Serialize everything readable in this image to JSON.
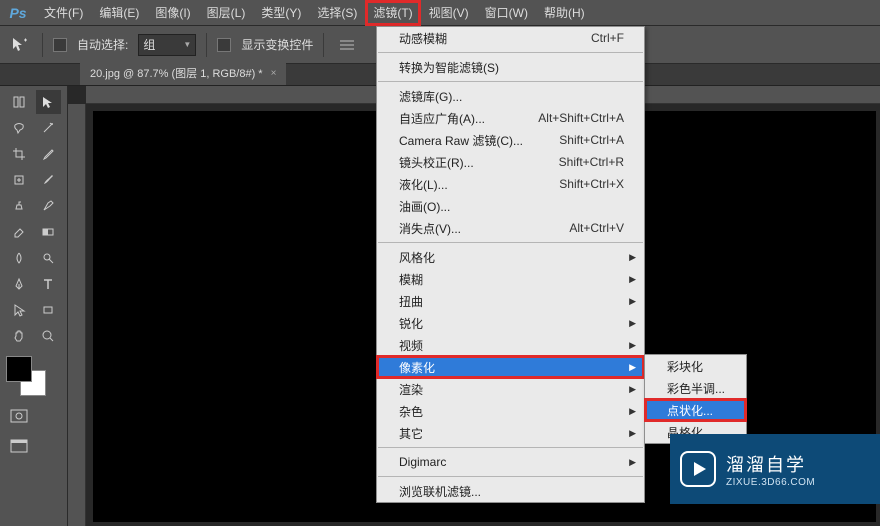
{
  "app": {
    "logo": "Ps"
  },
  "menubar": [
    "文件(F)",
    "编辑(E)",
    "图像(I)",
    "图层(L)",
    "类型(Y)",
    "选择(S)",
    "滤镜(T)",
    "视图(V)",
    "窗口(W)",
    "帮助(H)"
  ],
  "menubar_highlight_index": 6,
  "options": {
    "auto_select_label": "自动选择:",
    "auto_select_value": "组",
    "show_transform_label": "显示变换控件"
  },
  "tab": {
    "title": "20.jpg @ 87.7% (图层 1, RGB/8#) *",
    "close": "×"
  },
  "filter_menu": [
    {
      "label": "动感模糊",
      "shortcut": "Ctrl+F"
    },
    {
      "sep": true
    },
    {
      "label": "转换为智能滤镜(S)"
    },
    {
      "sep": true
    },
    {
      "label": "滤镜库(G)..."
    },
    {
      "label": "自适应广角(A)...",
      "shortcut": "Alt+Shift+Ctrl+A"
    },
    {
      "label": "Camera Raw 滤镜(C)...",
      "shortcut": "Shift+Ctrl+A"
    },
    {
      "label": "镜头校正(R)...",
      "shortcut": "Shift+Ctrl+R"
    },
    {
      "label": "液化(L)...",
      "shortcut": "Shift+Ctrl+X"
    },
    {
      "label": "油画(O)..."
    },
    {
      "label": "消失点(V)...",
      "shortcut": "Alt+Ctrl+V"
    },
    {
      "sep": true
    },
    {
      "label": "风格化",
      "sub": true
    },
    {
      "label": "模糊",
      "sub": true
    },
    {
      "label": "扭曲",
      "sub": true
    },
    {
      "label": "锐化",
      "sub": true
    },
    {
      "label": "视频",
      "sub": true
    },
    {
      "label": "像素化",
      "sub": true,
      "selected": true,
      "hl": true
    },
    {
      "label": "渲染",
      "sub": true
    },
    {
      "label": "杂色",
      "sub": true
    },
    {
      "label": "其它",
      "sub": true
    },
    {
      "sep": true
    },
    {
      "label": "Digimarc",
      "sub": true
    },
    {
      "sep": true
    },
    {
      "label": "浏览联机滤镜..."
    }
  ],
  "sub_menu": [
    {
      "label": "彩块化"
    },
    {
      "label": "彩色半调..."
    },
    {
      "label": "点状化...",
      "selected": true,
      "hl": true
    },
    {
      "label": "晶格化..."
    }
  ],
  "watermark": {
    "title": "溜溜自学",
    "url": "ZIXUE.3D66.COM"
  }
}
